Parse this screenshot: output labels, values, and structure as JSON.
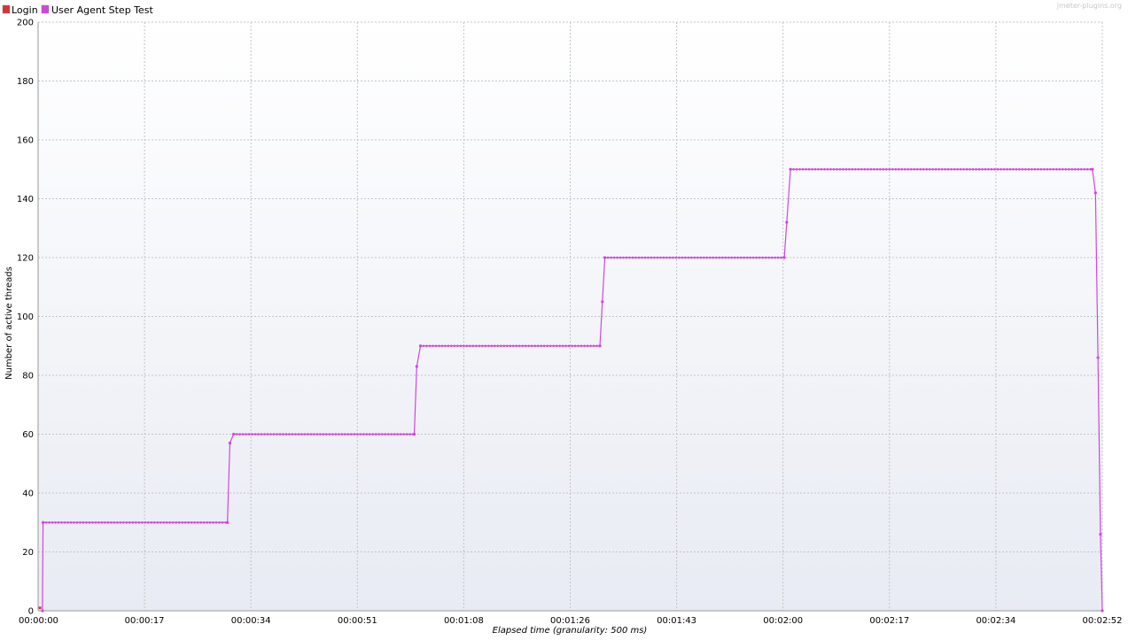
{
  "watermark": "jmeter-plugins.org",
  "legend": [
    {
      "label": "Login",
      "color": "#d83232"
    },
    {
      "label": "User Agent Step Test",
      "color": "#d244e0"
    }
  ],
  "chart_data": {
    "type": "line",
    "xlabel": "Elapsed time (granularity: 500 ms)",
    "ylabel": "Number of active threads",
    "xlim": [
      0,
      172
    ],
    "ylim": [
      0,
      200
    ],
    "y_ticks": [
      0,
      20,
      40,
      60,
      80,
      100,
      120,
      140,
      160,
      180,
      200
    ],
    "x_ticks": [
      {
        "value": 0,
        "label": "00:00:00"
      },
      {
        "value": 17.2,
        "label": "00:00:17"
      },
      {
        "value": 34.4,
        "label": "00:00:34"
      },
      {
        "value": 51.6,
        "label": "00:00:51"
      },
      {
        "value": 68.8,
        "label": "00:01:08"
      },
      {
        "value": 86,
        "label": "00:01:26"
      },
      {
        "value": 103.2,
        "label": "00:01:43"
      },
      {
        "value": 120.4,
        "label": "00:02:00"
      },
      {
        "value": 137.6,
        "label": "00:02:17"
      },
      {
        "value": 154.8,
        "label": "00:02:34"
      },
      {
        "value": 172,
        "label": "00:02:52"
      }
    ],
    "grid": true,
    "legend_position": "top-left",
    "series": [
      {
        "name": "Login",
        "color": "#d83232",
        "points": [
          [
            0.3,
            1
          ]
        ],
        "plateaus": []
      },
      {
        "name": "User Agent Step Test",
        "color": "#d244e0",
        "points": [
          [
            0.7,
            0
          ],
          [
            0.8,
            30
          ],
          [
            30.6,
            30
          ],
          [
            31.0,
            57
          ],
          [
            31.6,
            60
          ],
          [
            60.8,
            60
          ],
          [
            61.2,
            83
          ],
          [
            61.8,
            90
          ],
          [
            90.8,
            90
          ],
          [
            91.2,
            105
          ],
          [
            91.6,
            120
          ],
          [
            120.6,
            120
          ],
          [
            121.0,
            132
          ],
          [
            121.6,
            150
          ],
          [
            170.4,
            150
          ],
          [
            170.9,
            142
          ],
          [
            171.3,
            86
          ],
          [
            171.7,
            26
          ],
          [
            172,
            0
          ]
        ],
        "plateaus": [
          [
            0.8,
            30.6,
            30
          ],
          [
            31.6,
            60.8,
            60
          ],
          [
            61.8,
            90.8,
            90
          ],
          [
            91.6,
            120.6,
            120
          ],
          [
            121.6,
            170.4,
            150
          ]
        ]
      }
    ]
  }
}
